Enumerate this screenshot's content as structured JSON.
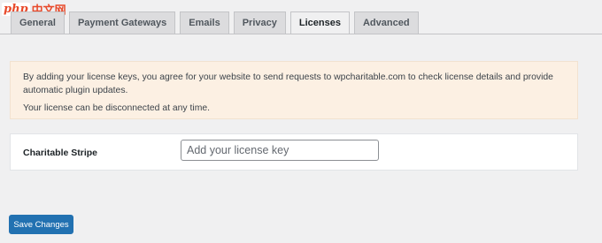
{
  "watermark": {
    "brand": "php",
    "site": "中文网"
  },
  "tabs": [
    {
      "label": "General",
      "active": false
    },
    {
      "label": "Payment Gateways",
      "active": false
    },
    {
      "label": "Emails",
      "active": false
    },
    {
      "label": "Privacy",
      "active": false
    },
    {
      "label": "Licenses",
      "active": true
    },
    {
      "label": "Advanced",
      "active": false
    }
  ],
  "notice": {
    "line1": "By adding your license keys, you agree for your website to send requests to wpcharitable.com to check license details and provide automatic plugin updates.",
    "line2": "Your license can be disconnected at any time."
  },
  "license": {
    "label": "Charitable Stripe",
    "value": "",
    "placeholder": "Add your license key"
  },
  "actions": {
    "save_label": "Save Changes"
  },
  "colors": {
    "primary_button": "#2271b1",
    "notice_bg": "#fcf0e3",
    "page_bg": "#f0f0f1"
  }
}
